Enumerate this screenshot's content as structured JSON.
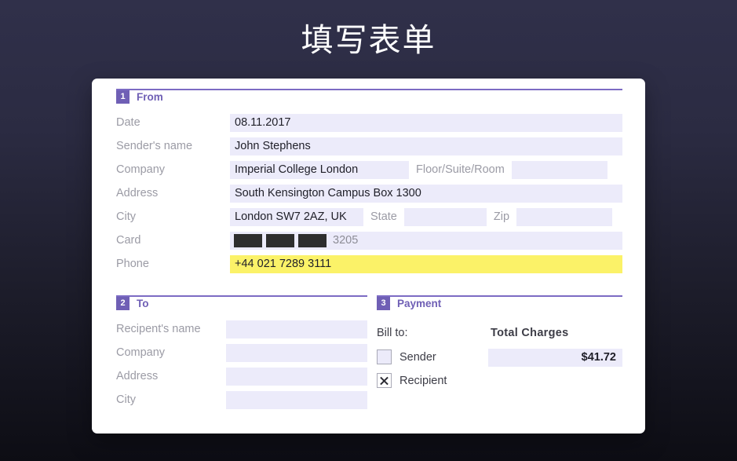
{
  "page": {
    "title": "填写表单"
  },
  "form": {
    "sections": [
      {
        "number": "1",
        "label": "From"
      },
      {
        "number": "2",
        "label": "To"
      },
      {
        "number": "3",
        "label": "Payment"
      }
    ],
    "from": {
      "date": {
        "label": "Date",
        "value": "08.11.2017"
      },
      "sender_name": {
        "label": "Sender's name",
        "value": "John Stephens"
      },
      "company": {
        "label": "Company",
        "value": "Imperial College London"
      },
      "floor": {
        "label": "Floor/Suite/Room",
        "value": ""
      },
      "address": {
        "label": "Address",
        "value": "South Kensington Campus Box 1300"
      },
      "city": {
        "label": "City",
        "value": "London SW7 2AZ, UK"
      },
      "state": {
        "label": "State",
        "value": ""
      },
      "zip": {
        "label": "Zip",
        "value": ""
      },
      "card": {
        "label": "Card",
        "redacted_blocks": 3,
        "value": "3205"
      },
      "phone": {
        "label": "Phone",
        "value": "+44 021 7289 3111",
        "highlighted": true
      }
    },
    "to": {
      "recipient_name": {
        "label": "Recipent's name",
        "value": ""
      },
      "company": {
        "label": "Company",
        "value": ""
      },
      "address": {
        "label": "Address",
        "value": ""
      },
      "city": {
        "label": "City",
        "value": ""
      }
    },
    "payment": {
      "bill_to_label": "Bill to:",
      "totals_header": "Total  Charges",
      "total_amount": "$41.72",
      "options": [
        {
          "label": "Sender",
          "checked": false
        },
        {
          "label": "Recipient",
          "checked": true
        }
      ]
    }
  },
  "colors": {
    "accent_purple": "#6f5fb5",
    "rule_purple": "#7c6bc4",
    "input_fill": "#ecebfa",
    "highlight_yellow": "#fbf268",
    "label_gray": "#9b9ba5",
    "card_white": "#ffffff",
    "bg_top": "#30304a",
    "bg_bottom": "#0d0d14"
  }
}
